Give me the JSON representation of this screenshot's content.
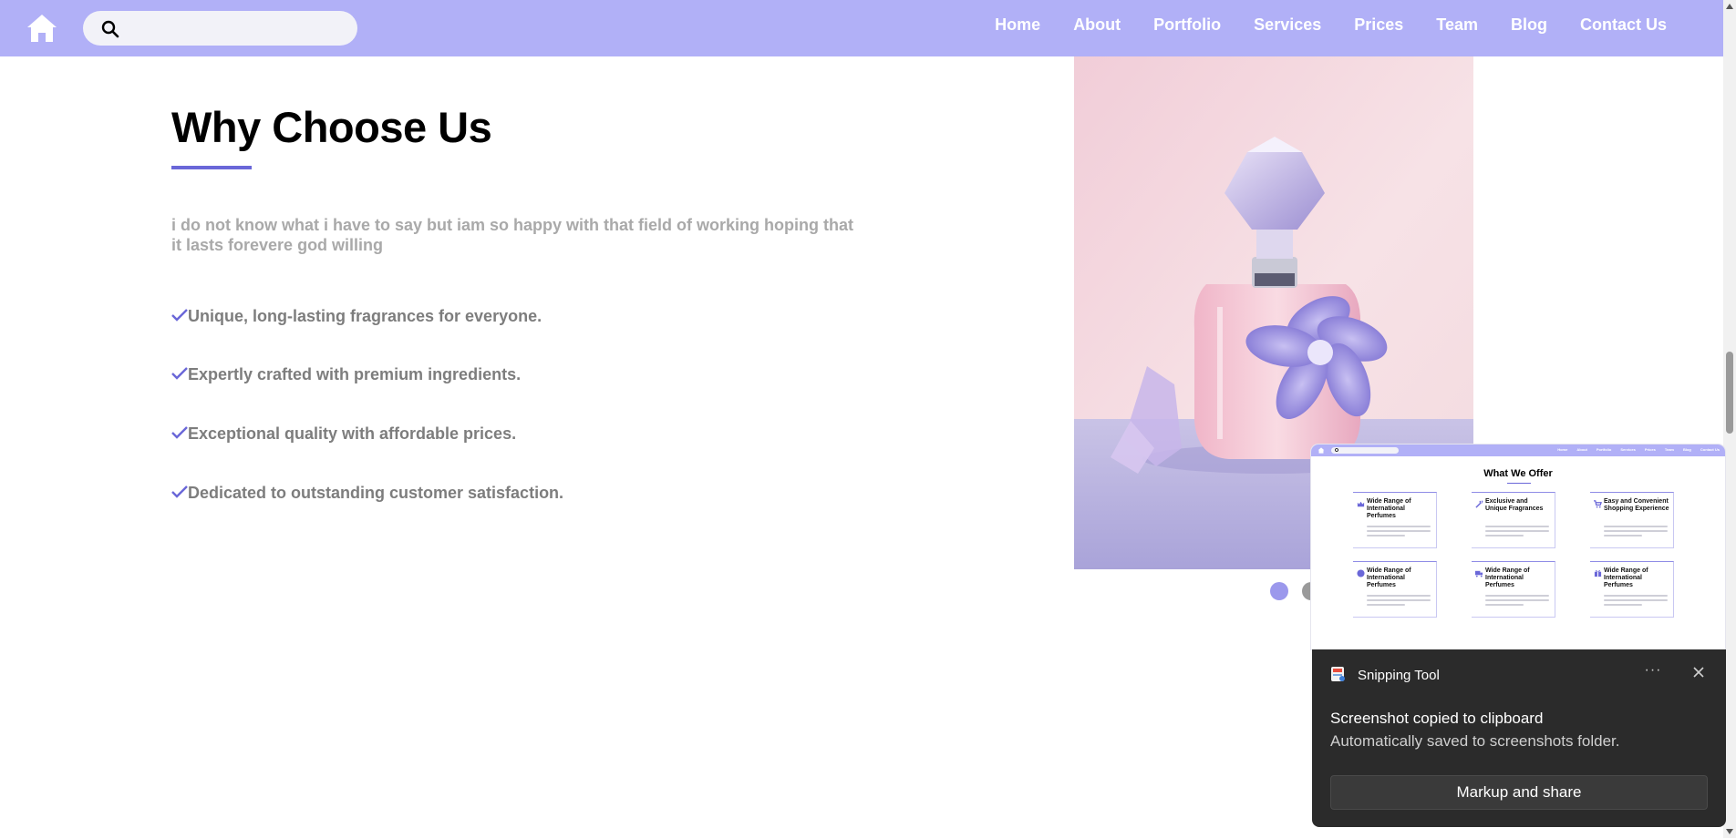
{
  "search": {
    "placeholder": ""
  },
  "nav": {
    "links": [
      "Home",
      "About",
      "Portfolio",
      "Services",
      "Prices",
      "Team",
      "Blog",
      "Contact Us"
    ]
  },
  "section": {
    "title": "Why Choose Us",
    "intro": "i do not know what i have to say but iam so happy with that field of working hoping that it lasts forevere god willing",
    "features": [
      "Unique, long-lasting fragrances for everyone.",
      "Expertly crafted with premium ingredients.",
      "Exceptional quality with affordable prices.",
      "Dedicated to outstanding customer satisfaction."
    ]
  },
  "carousel": {
    "slide_count": 2,
    "active_index": 0
  },
  "thumbnail": {
    "title": "What We Offer",
    "nav_links": [
      "Home",
      "About",
      "Portfolio",
      "Services",
      "Prices",
      "Team",
      "Blog",
      "Contact Us"
    ],
    "cards": [
      {
        "icon": "crown-icon",
        "title": "Wide Range of International Perfumes"
      },
      {
        "icon": "wand-icon",
        "title": "Exclusive and Unique Fragrances"
      },
      {
        "icon": "cart-icon",
        "title": "Easy and Convenient Shopping Experience"
      },
      {
        "icon": "circle-icon",
        "title": "Wide Range of International Perfumes"
      },
      {
        "icon": "truck-icon",
        "title": "Wide Range of International Perfumes"
      },
      {
        "icon": "gift-icon",
        "title": "Wide Range of International Perfumes"
      }
    ]
  },
  "toast": {
    "app_name": "Snipping Tool",
    "title": "Screenshot copied to clipboard",
    "subtitle": "Automatically saved to screenshots folder.",
    "button": "Markup and share",
    "more_label": "···"
  },
  "colors": {
    "nav_bg": "#b1b0f7",
    "accent": "#6a67d8",
    "intro_text": "#a9a9a9",
    "feature_text": "#7d7d7d",
    "toast_bg": "#2b2b2b"
  }
}
